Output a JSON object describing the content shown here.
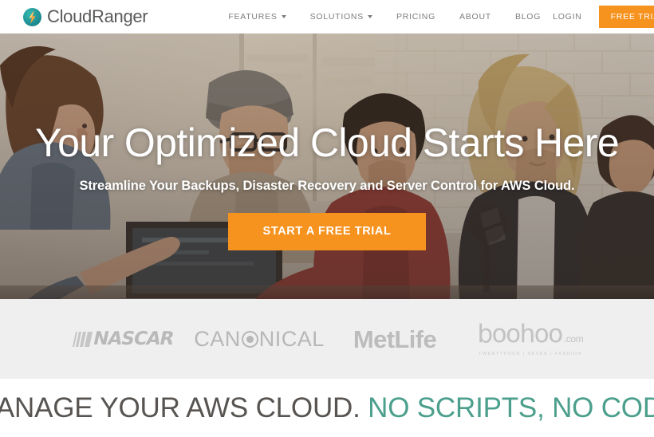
{
  "brand": {
    "name": "CloudRanger",
    "logo_icon": "lightning-bolt-circle-icon",
    "mark_color": "#1f8f95",
    "bolt_color": "#f7941e"
  },
  "header": {
    "nav": [
      {
        "label": "FEATURES",
        "has_caret": true
      },
      {
        "label": "SOLUTIONS",
        "has_caret": true
      },
      {
        "label": "PRICING",
        "has_caret": false
      },
      {
        "label": "ABOUT",
        "has_caret": false
      },
      {
        "label": "BLOG",
        "has_caret": false
      }
    ],
    "login_label": "LOGIN",
    "trial_label": "FREE TRIAL",
    "accent_color": "#f6921e"
  },
  "hero": {
    "title": "Your Optimized Cloud Starts Here",
    "subtitle": "Streamline Your Backups, Disaster Recovery and Server Control for AWS Cloud.",
    "cta_label": "START A FREE TRIAL",
    "cta_color": "#f6921e",
    "image_description": "Group of young people collaborating around a desk in a bright office with a white brick wall"
  },
  "logobar": {
    "background": "#efefef",
    "clients": [
      {
        "name": "NASCAR",
        "wordmark": "NASCAR"
      },
      {
        "name": "Canonical",
        "wordmark_before": "CAN",
        "wordmark_after": "NICAL"
      },
      {
        "name": "MetLife",
        "wordmark": "MetLife"
      },
      {
        "name": "boohoo.com",
        "wordmark": "boohoo",
        "suffix": ".com",
        "tagline": "TWENTYFOUR  |  SEVEN  |  FASHION"
      }
    ]
  },
  "bottom_section": {
    "headline_dark": "MANAGE YOUR AWS CLOUD.",
    "headline_teal": " NO SCRIPTS, NO CODE",
    "teal_color": "#4b9f8c",
    "dark_color": "#575451"
  }
}
